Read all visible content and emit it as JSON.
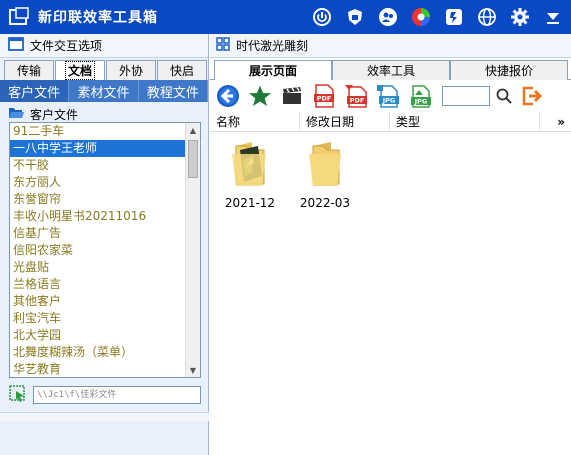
{
  "app": {
    "title": "新印联效率工具箱"
  },
  "left": {
    "header": "文件交互选项",
    "tabs": [
      "传输",
      "文档",
      "外协",
      "快启"
    ],
    "active_tab": 1,
    "subtabs": [
      "客户文件",
      "素材文件",
      "教程文件"
    ],
    "section_title": "客户文件",
    "list": [
      "91二手车",
      "一八中学王老师",
      "不干胶",
      "东方丽人",
      "东誉窗帘",
      "丰收小明星书20211016",
      "信基广告",
      "信阳农家菜",
      "光盘贴",
      "兰格语言",
      "其他客户",
      "利宝汽车",
      "北大学园",
      "北舞度糊辣汤（菜单）",
      "华艺教育"
    ],
    "selected_index": 1,
    "path": "\\\\Jc1\\f\\佳彩文件"
  },
  "right": {
    "header": "时代激光雕刻",
    "tabs": [
      "展示页面",
      "效率工具",
      "快捷报价"
    ],
    "active_tab": 0,
    "columns": {
      "name": "名称",
      "date": "修改日期",
      "type": "类型",
      "more": "»"
    },
    "files": [
      {
        "name": "2021-12",
        "variant": "special"
      },
      {
        "name": "2022-03",
        "variant": "plain"
      }
    ]
  },
  "colors": {
    "titlebar": "#0a49c4",
    "tab_blue": "#3f78c9",
    "selected": "#1e73d6",
    "list_text": "#8a7a1e"
  }
}
